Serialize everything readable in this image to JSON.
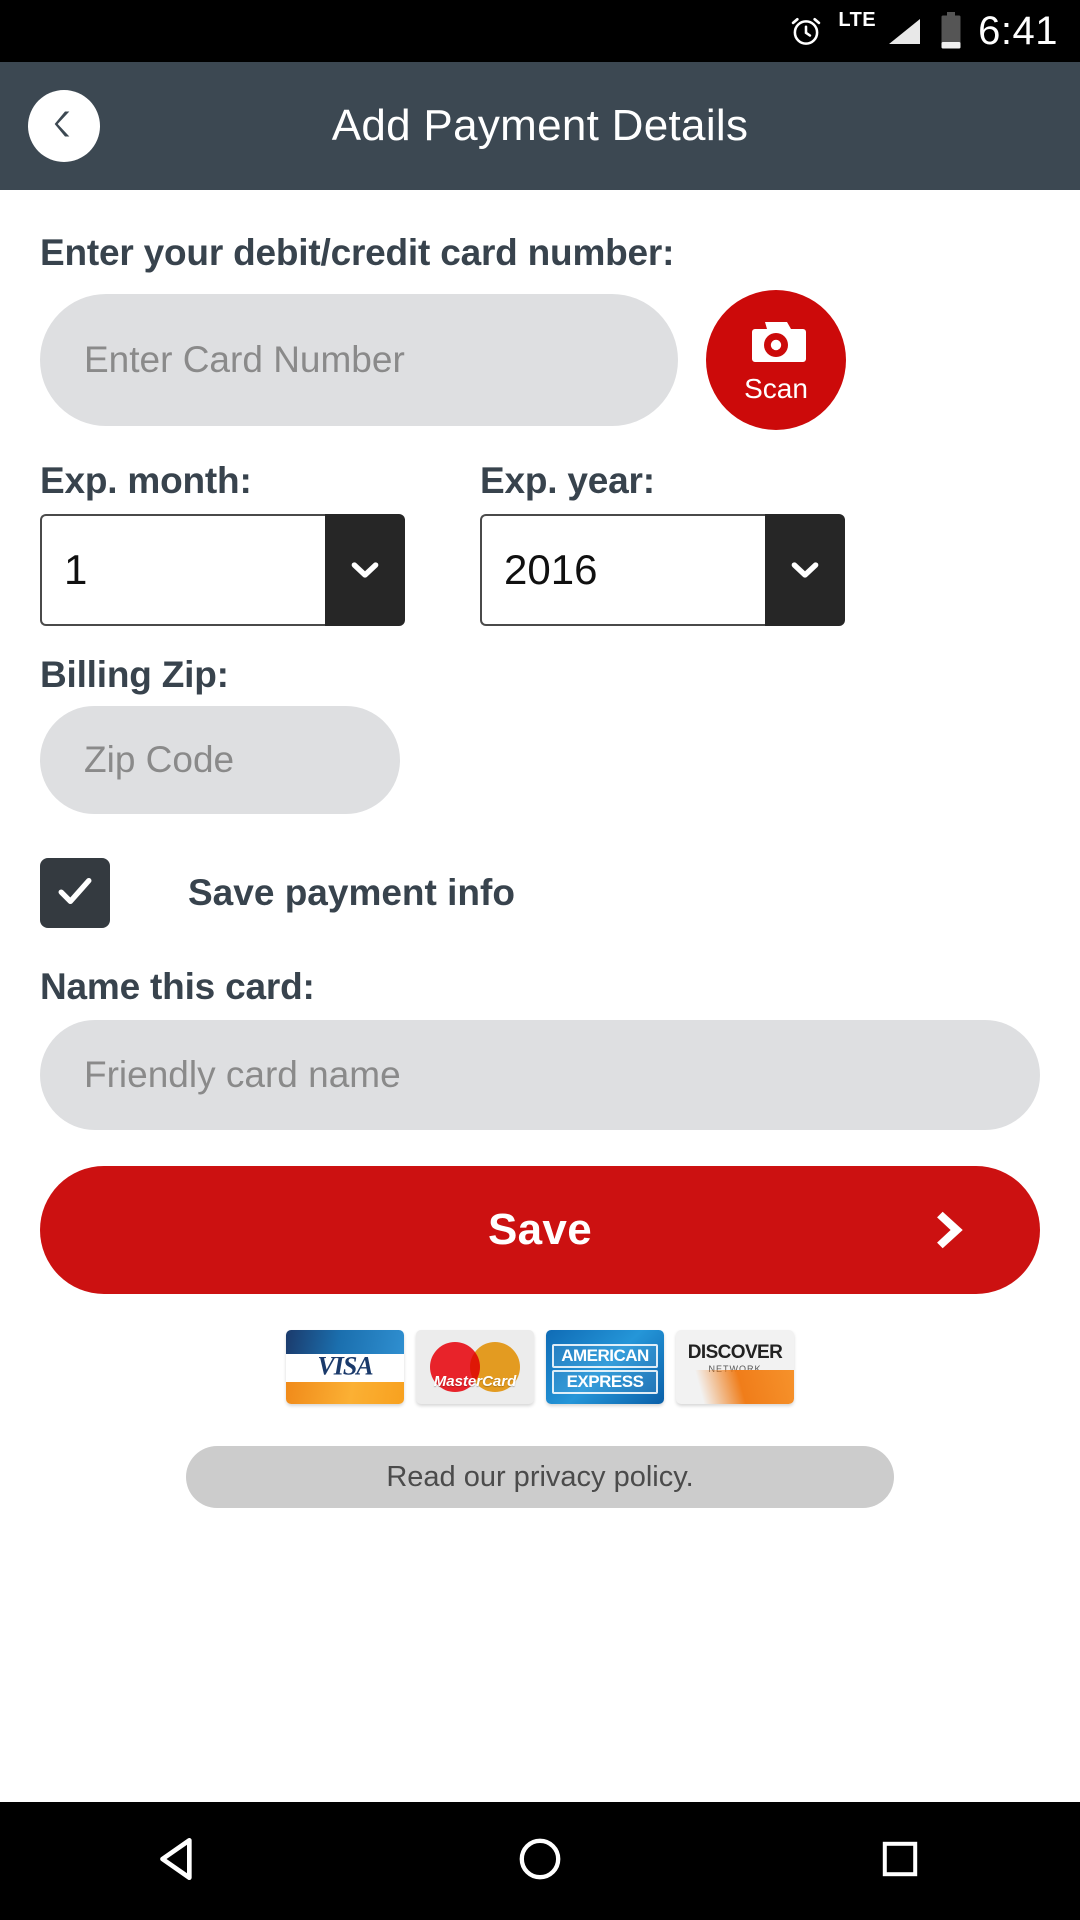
{
  "status_bar": {
    "time": "6:41",
    "network_label": "LTE",
    "icons": [
      "alarm-clock-icon",
      "lte-label",
      "signal-icon",
      "battery-icon"
    ]
  },
  "header": {
    "title": "Add Payment Details",
    "back_icon": "chevron-left-icon",
    "background_color": "#3c4852"
  },
  "form": {
    "card_number": {
      "label": "Enter your debit/credit card number:",
      "placeholder": "Enter Card Number",
      "value": ""
    },
    "scan_button": {
      "label": "Scan",
      "icon": "camera-icon",
      "color": "#cc0a0a"
    },
    "exp_month": {
      "label": "Exp. month:",
      "value": "1",
      "arrow_icon": "chevron-down-icon"
    },
    "exp_year": {
      "label": "Exp. year:",
      "value": "2016",
      "arrow_icon": "chevron-down-icon"
    },
    "billing_zip": {
      "label": "Billing Zip:",
      "placeholder": "Zip Code",
      "value": ""
    },
    "save_payment_info": {
      "label": "Save payment info",
      "checked": "true",
      "check_icon": "check-icon"
    },
    "card_name": {
      "label": "Name this card:",
      "placeholder": "Friendly card name",
      "value": ""
    },
    "save_button": {
      "label": "Save",
      "arrow_icon": "chevron-right-icon",
      "color": "#cc1111"
    }
  },
  "card_logos": [
    {
      "name": "VISA"
    },
    {
      "name": "MasterCard"
    },
    {
      "name": "AMERICAN",
      "line2": "EXPRESS"
    },
    {
      "name": "DISCOVER",
      "line2": "NETWORK"
    }
  ],
  "privacy": {
    "label": "Read our privacy policy."
  },
  "nav_bar": {
    "back": "triangle-back-icon",
    "home": "circle-home-icon",
    "recents": "square-recents-icon"
  }
}
